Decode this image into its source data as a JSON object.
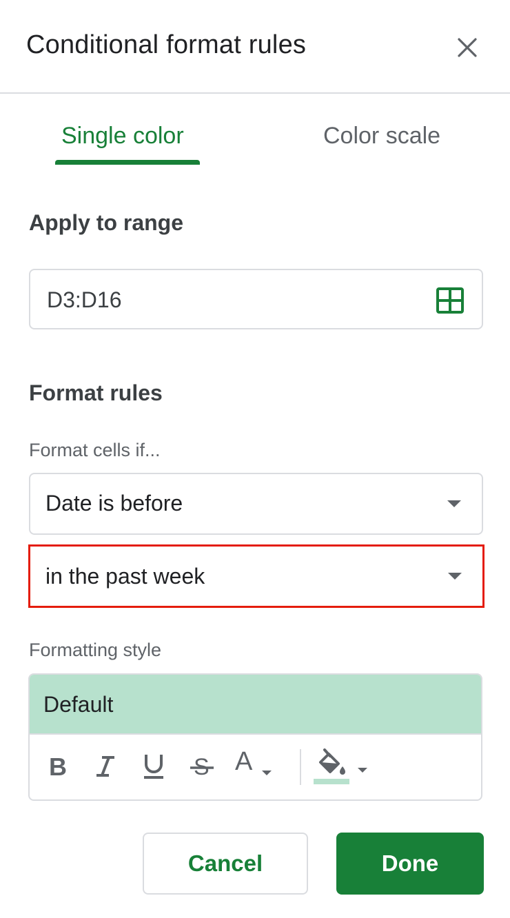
{
  "header": {
    "title": "Conditional format rules"
  },
  "tabs": [
    {
      "label": "Single color",
      "active": true
    },
    {
      "label": "Color scale",
      "active": false
    }
  ],
  "apply": {
    "label": "Apply to range",
    "range_value": "D3:D16"
  },
  "rules": {
    "label": "Format rules",
    "condition_label": "Format cells if...",
    "condition_value": "Date is before",
    "date_value": "in the past week"
  },
  "style": {
    "label": "Formatting style",
    "preset_label": "Default",
    "preset_color": "#b7e1cd",
    "text_color_glyph": "A",
    "tools": [
      "bold-icon",
      "italic-icon",
      "underline-icon",
      "strikethrough-icon",
      "text-color-icon",
      "fill-color-icon"
    ]
  },
  "footer": {
    "cancel_label": "Cancel",
    "done_label": "Done"
  },
  "colors": {
    "accent": "#188038",
    "highlight_border": "#e41c0c"
  }
}
